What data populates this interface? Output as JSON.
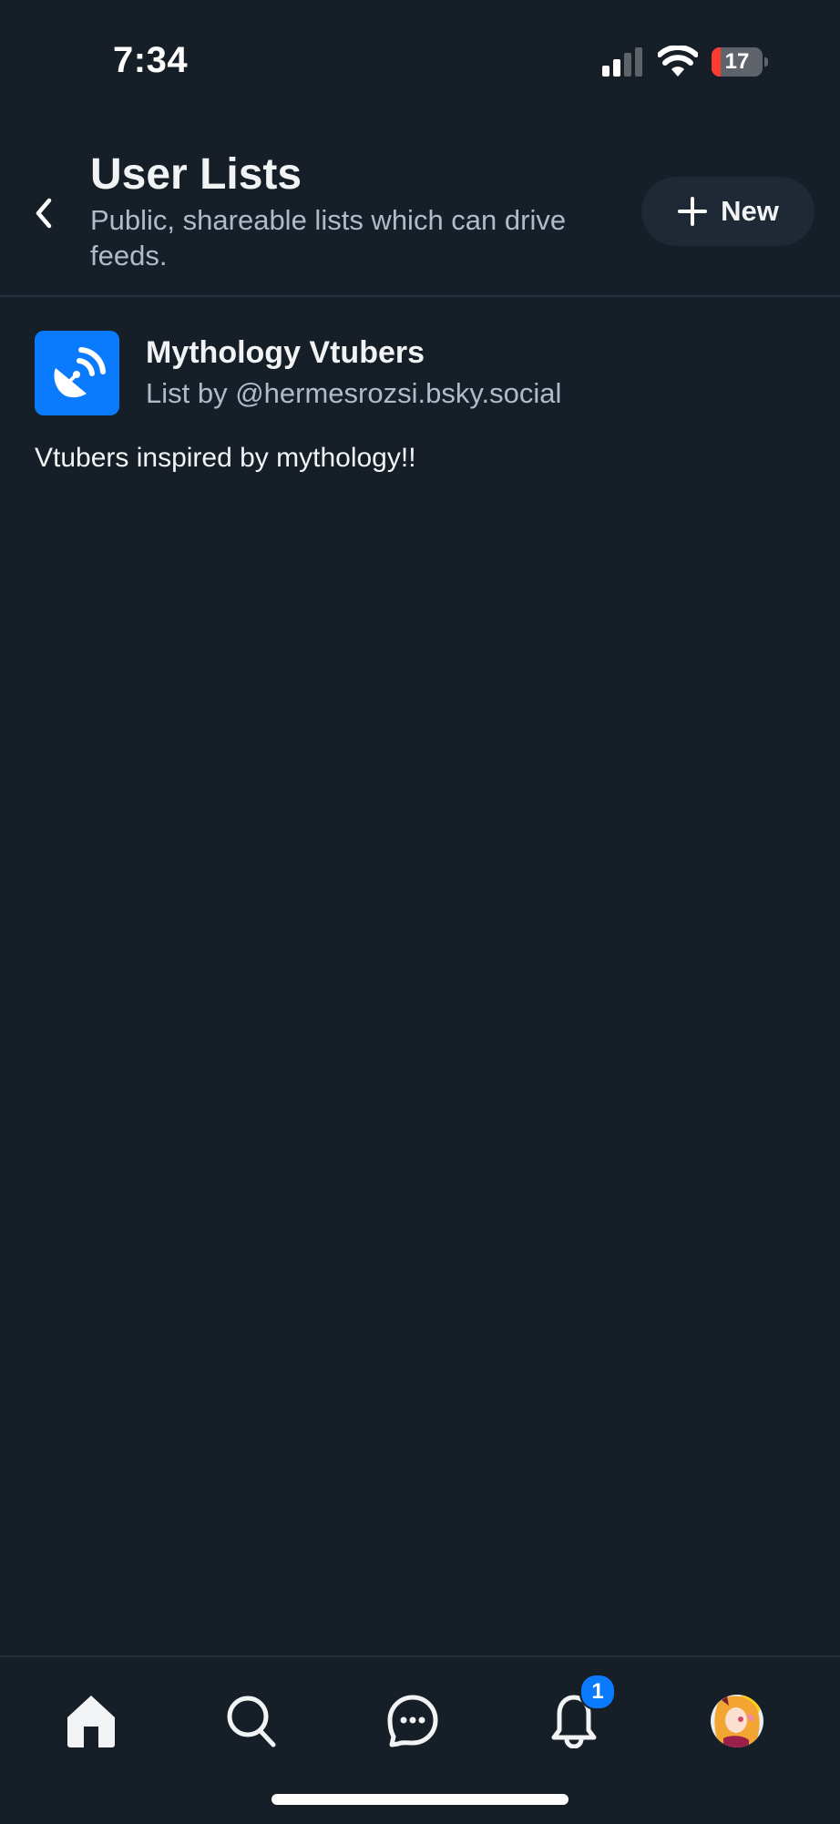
{
  "status_bar": {
    "time": "7:34",
    "battery_level": "17",
    "battery_fraction": 0.17,
    "signal_bars_active": 2,
    "signal_bars_total": 4
  },
  "header": {
    "back_icon": "chevron-left-icon",
    "title": "User Lists",
    "subtitle": "Public, shareable lists which can drive feeds.",
    "new_button_icon": "plus-icon",
    "new_button_label": "New"
  },
  "lists": [
    {
      "icon": "satellite-dish-icon",
      "avatar_color": "#0a7aff",
      "name": "Mythology Vtubers",
      "byline": "List by @hermesrozsi.bsky.social",
      "description": "Vtubers inspired by mythology!!"
    }
  ],
  "bottom_nav": {
    "items": [
      {
        "name": "home",
        "icon": "home-icon",
        "active": true
      },
      {
        "name": "search",
        "icon": "search-icon"
      },
      {
        "name": "chat",
        "icon": "chat-bubble-icon"
      },
      {
        "name": "notifications",
        "icon": "bell-icon",
        "badge": "1"
      },
      {
        "name": "profile",
        "icon": "avatar"
      }
    ]
  },
  "colors": {
    "background": "#161e27",
    "accent": "#0a7aff",
    "muted_text": "#aebbc9",
    "battery_low": "#ff3b30"
  }
}
